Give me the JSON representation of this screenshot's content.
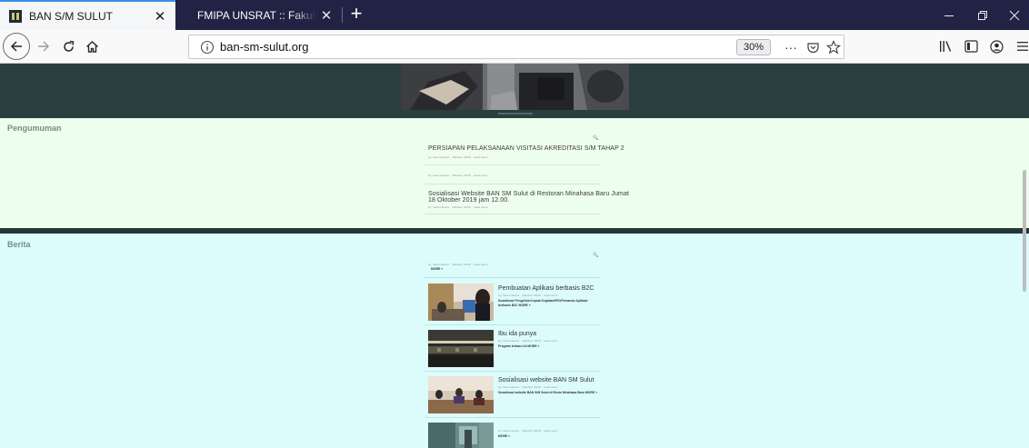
{
  "browser": {
    "tabs": [
      {
        "title": "BAN S/M SULUT",
        "active": true
      },
      {
        "title": "FMIPA UNSRAT :: Fakultas MIPA",
        "active": false
      }
    ],
    "url": "ban-sm-sulut.org",
    "zoom": "30%"
  },
  "page": {
    "sections": {
      "announcements_label": "Pengumuman",
      "news_label": "Berita"
    },
    "announcements": [
      {
        "title": "PERSIAPAN PELAKSANAAN VISITASI AKREDITASI S/M TAHAP 2"
      },
      {
        "title": ""
      },
      {
        "title_line1": "Sosialisasi Website BAN SM Sulut di Restoran Minahasa Baru Jumat",
        "title_line2": "18 Oktober 2019 jam 12.00."
      }
    ],
    "news": [
      {
        "title": "",
        "excerpt": "MORE »"
      },
      {
        "title": "Pembuatan Aplikasi berbasis B2C",
        "excerpt_line1": "Sosialisasi Pengelola Kepala Kegiatan/PIC/Pemandu Aplikasi",
        "excerpt_line2": "berbasis B2C MORE »"
      },
      {
        "title": "Ibu ida punya",
        "excerpt": "Program terbaru ini MORE »"
      },
      {
        "title": "Sosialisasi website BAN SM Sulut",
        "excerpt": "Sosialisasi website BAN S/M Sulut di Resto Minahasa Baru MORE »"
      },
      {
        "title": "",
        "excerpt": "MORE »"
      }
    ],
    "meta_text": "by: bansmsulut · Oktober 2019 · read more"
  },
  "colors": {
    "tabstrip": "#222244",
    "header_band": "#2b3e3e",
    "announcement_bg": "#eefeee",
    "news_bg": "#dcfcfc"
  }
}
